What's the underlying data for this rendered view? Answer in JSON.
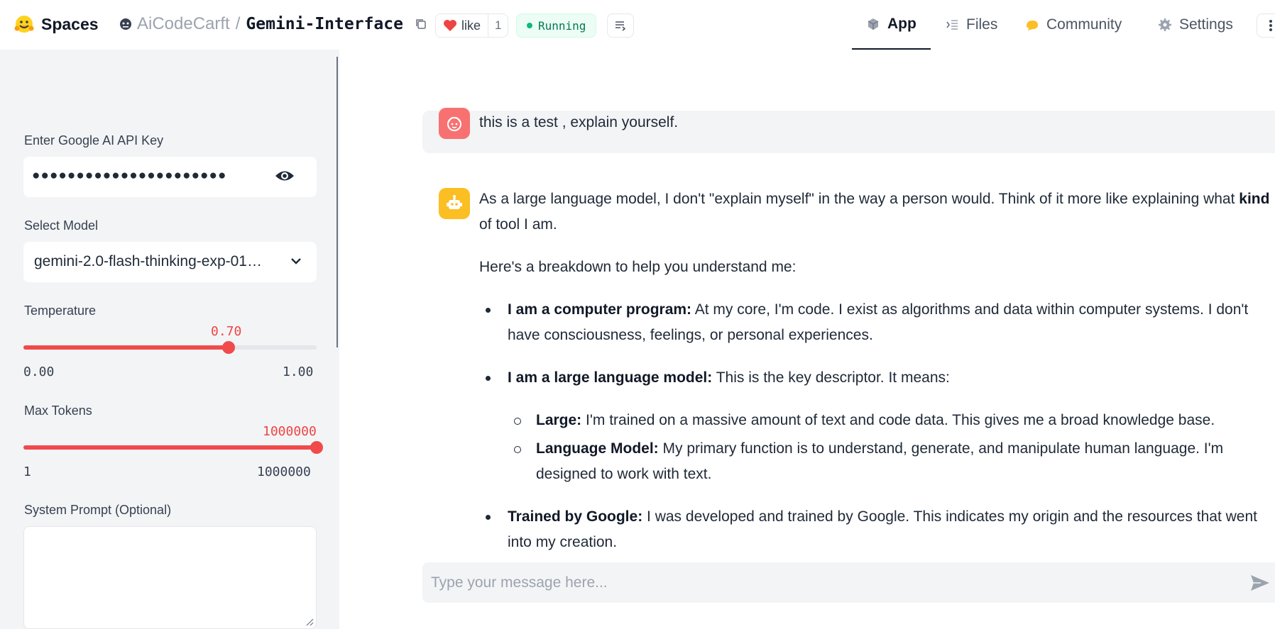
{
  "header": {
    "brand": "Spaces",
    "owner": "AiCodeCarft",
    "separator": "/",
    "repo": "Gemini-Interface",
    "like_label": "like",
    "like_count": "1",
    "status": "Running",
    "nav": [
      {
        "label": "App",
        "icon": "cube-icon",
        "active": true
      },
      {
        "label": "Files",
        "icon": "files-icon",
        "active": false
      },
      {
        "label": "Community",
        "icon": "community-icon",
        "active": false
      },
      {
        "label": "Settings",
        "icon": "gear-icon",
        "active": false
      }
    ]
  },
  "sidebar": {
    "api_key": {
      "label": "Enter Google AI API Key",
      "masked_value": "●●●●●●●●●●●●●●●●●●●●●●"
    },
    "model": {
      "label": "Select Model",
      "selected": "gemini-2.0-flash-thinking-exp-01…"
    },
    "temperature": {
      "label": "Temperature",
      "value": "0.70",
      "fraction": 0.7,
      "min": "0.00",
      "max": "1.00"
    },
    "max_tokens": {
      "label": "Max Tokens",
      "value": "1000000",
      "fraction": 1.0,
      "min": "1",
      "max": "1000000"
    },
    "system_prompt": {
      "label": "System Prompt (Optional)",
      "value": ""
    }
  },
  "chat": {
    "user_message": "this is a test , explain yourself.",
    "bot": {
      "intro_1": "As a large language model, I don't \"explain myself\" in the way a person would. Think of it more like explaining what ",
      "intro_bold": "kind",
      "intro_2": " of tool I am.",
      "breakdown": "Here's a breakdown to help you understand me:",
      "items": [
        {
          "title": "I am a computer program:",
          "text": " At my core, I'm code. I exist as algorithms and data within computer systems. I don't have consciousness, feelings, or personal experiences."
        },
        {
          "title": "I am a large language model:",
          "text": " This is the key descriptor. It means:"
        },
        {
          "title": "Trained by Google:",
          "text": " I was developed and trained by Google. This indicates my origin and the resources that went into my creation."
        }
      ],
      "subitems": [
        {
          "title": "Large:",
          "text": " I'm trained on a massive amount of text and code data. This gives me a broad knowledge base."
        },
        {
          "title": "Language Model:",
          "text": " My primary function is to understand, generate, and manipulate human language. I'm designed to work with text."
        }
      ]
    },
    "input_placeholder": "Type your message here..."
  },
  "colors": {
    "accent": "#f04a4a",
    "running": "#10b981",
    "user_avatar": "#f87171",
    "bot_avatar": "#fbbf24"
  }
}
